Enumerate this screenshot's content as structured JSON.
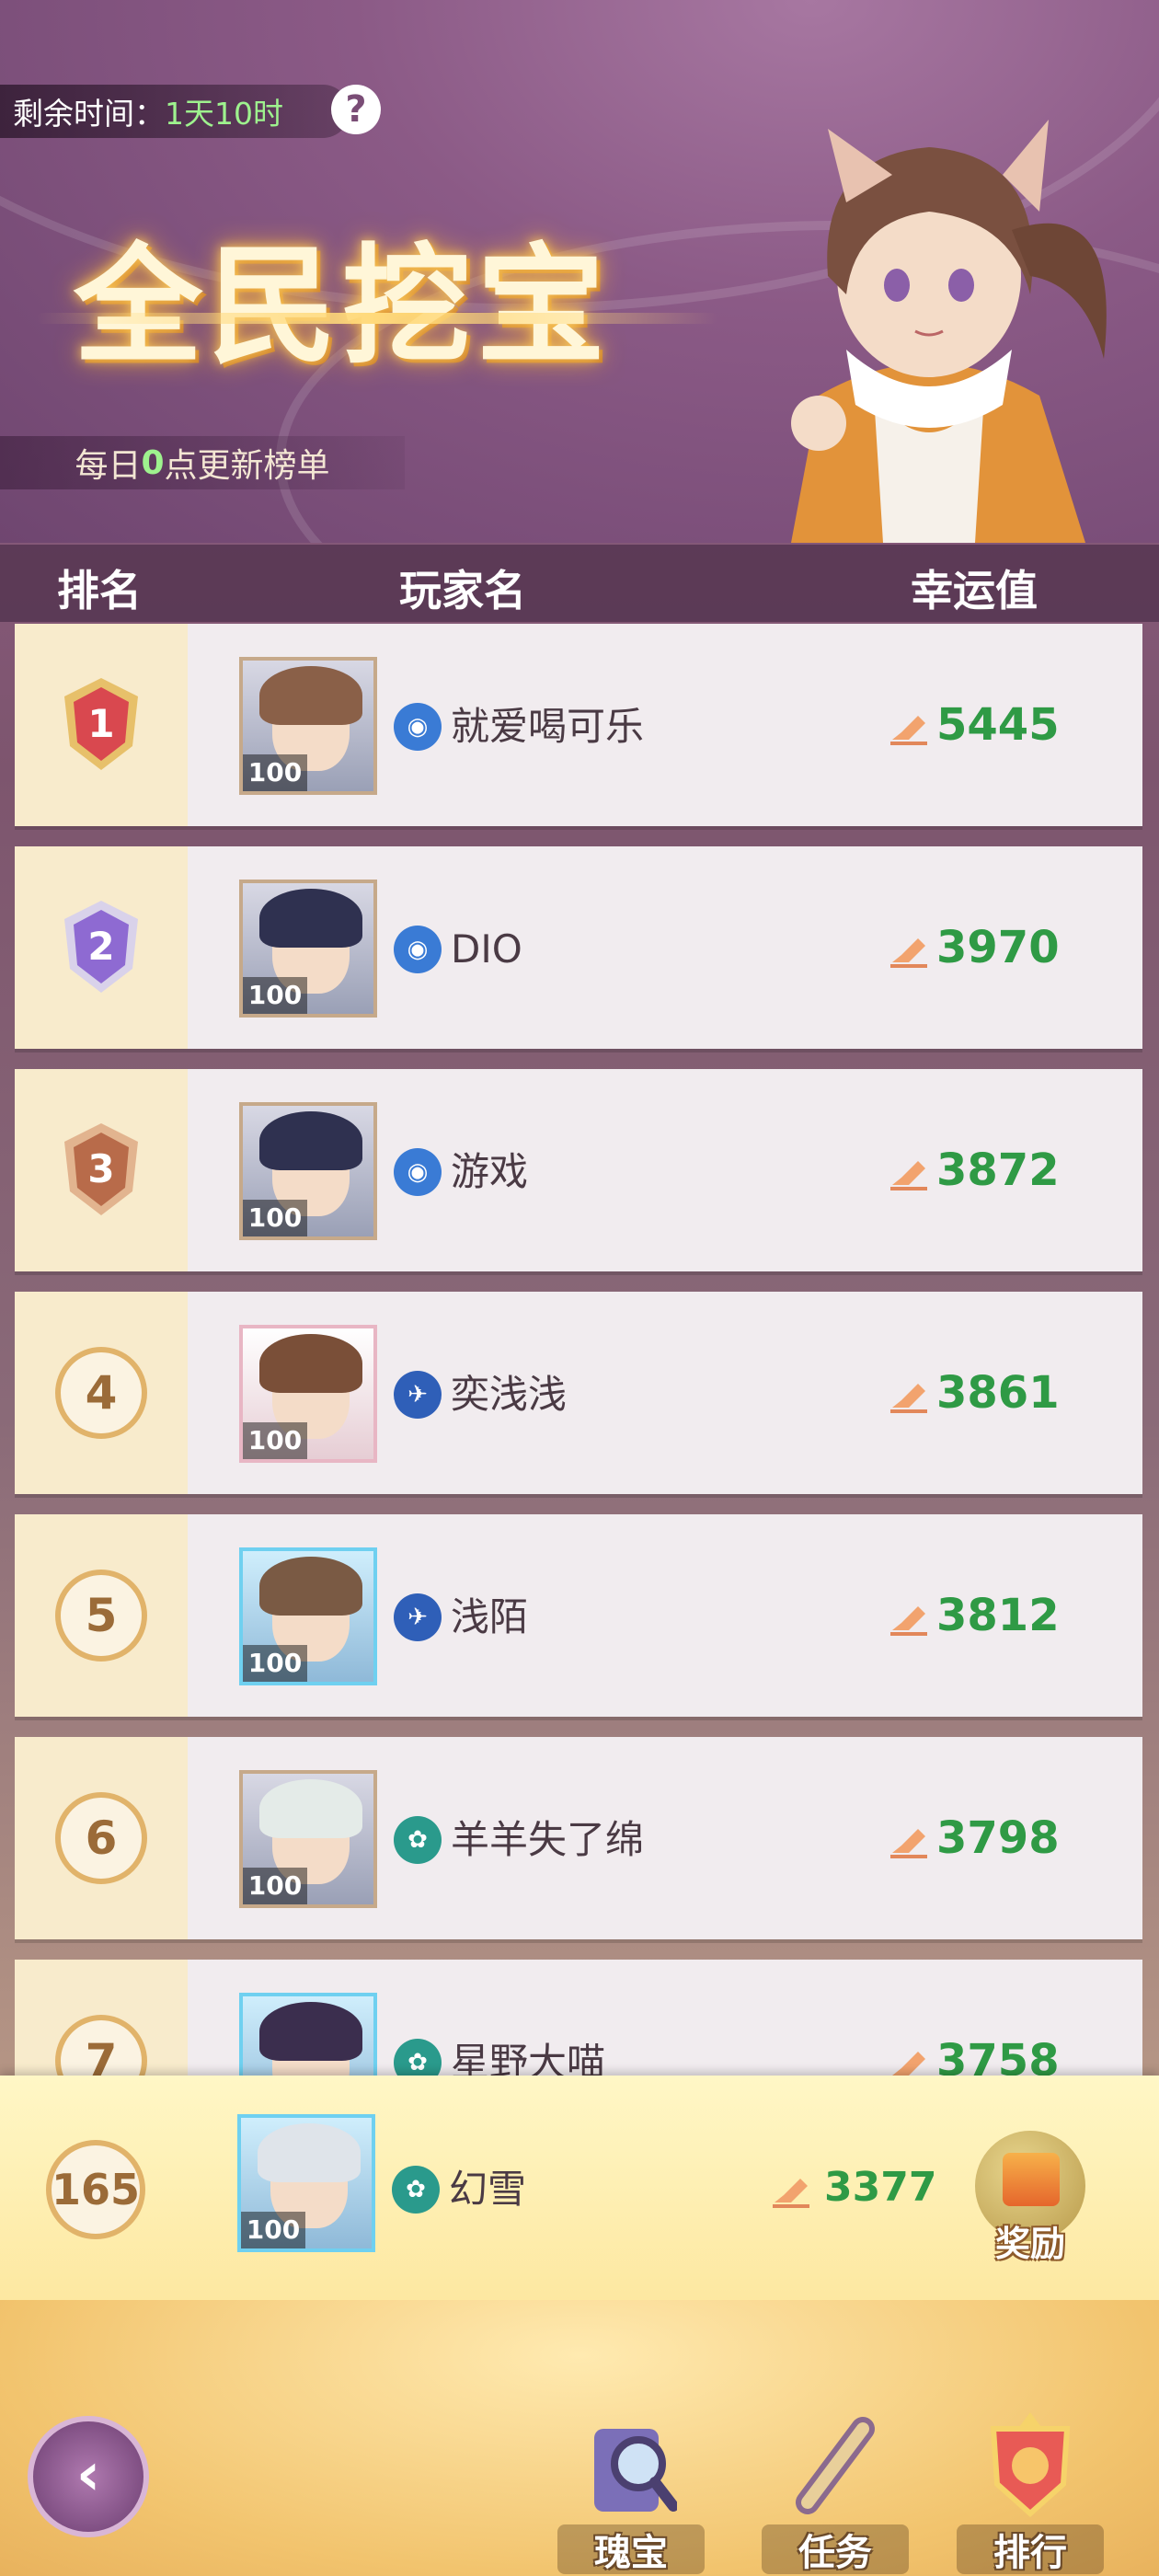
{
  "header": {
    "timer_label": "剩余时间：",
    "timer_value": "1天10时",
    "help_symbol": "?",
    "title": "全民挖宝",
    "daily_prefix": "每日",
    "daily_highlight": "0",
    "daily_suffix": "点更新榜单"
  },
  "columns": {
    "rank": "排名",
    "player": "玩家名",
    "luck": "幸运值"
  },
  "rows": [
    {
      "rank": "1",
      "level": "100",
      "name": "就爱喝可乐",
      "score": "5445",
      "server_color": "#3a7bd5",
      "medal_color": "#d9484f"
    },
    {
      "rank": "2",
      "level": "100",
      "name": "DIO",
      "score": "3970",
      "server_color": "#3a7bd5",
      "medal_color": "#8e6ad2"
    },
    {
      "rank": "3",
      "level": "100",
      "name": "游戏",
      "score": "3872",
      "server_color": "#3a7bd5",
      "medal_color": "#b86b4a"
    },
    {
      "rank": "4",
      "level": "100",
      "name": "奕浅浅",
      "score": "3861",
      "server_color": "#2f5fb8"
    },
    {
      "rank": "5",
      "level": "100",
      "name": "浅陌",
      "score": "3812",
      "server_color": "#2f5fb8"
    },
    {
      "rank": "6",
      "level": "100",
      "name": "羊羊失了绵",
      "score": "3798",
      "server_color": "#2a9a8c"
    },
    {
      "rank": "7",
      "level": "",
      "name": "星野大喵",
      "score": "3758",
      "server_color": "#2a9a8c"
    }
  ],
  "self": {
    "rank": "165",
    "level": "100",
    "name": "幻雪",
    "score": "3377",
    "server_color": "#2a9a8c",
    "reward_label": "奖励"
  },
  "nav": {
    "back_symbol": "‹",
    "items": [
      {
        "label": "瑰宝",
        "icon": "scroll-magnifier-icon"
      },
      {
        "label": "任务",
        "icon": "scroll-icon"
      },
      {
        "label": "排行",
        "icon": "ranking-shield-icon"
      }
    ]
  },
  "colors": {
    "score_green": "#2f9a45",
    "timer_green": "#9ef28e",
    "rank_cell_bg": "#f8ebcc",
    "self_bg": "#fff7c6"
  }
}
